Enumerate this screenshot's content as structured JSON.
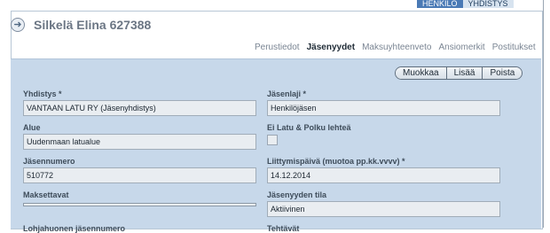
{
  "top_tabs": [
    {
      "label": "HENKILÖ",
      "active": true
    },
    {
      "label": "YHDISTYS",
      "active": false
    }
  ],
  "header": {
    "title": "Silkelä Elina 627388"
  },
  "subnav": [
    {
      "label": "Perustiedot",
      "active": false
    },
    {
      "label": "Jäsenyydet",
      "active": true
    },
    {
      "label": "Maksuyhteenveto",
      "active": false
    },
    {
      "label": "Ansiomerkit",
      "active": false
    },
    {
      "label": "Postitukset",
      "active": false
    }
  ],
  "actions": {
    "edit": "Muokkaa",
    "add": "Lisää",
    "delete": "Poista"
  },
  "fields": {
    "yhdistys": {
      "label": "Yhdistys *",
      "value": "VANTAAN LATU RY (Jäsenyhdistys)"
    },
    "jasenlaji": {
      "label": "Jäsenlaji *",
      "value": "Henkilöjäsen"
    },
    "alue": {
      "label": "Alue",
      "value": "Uudenmaan latualue"
    },
    "ei_latu_polku": {
      "label": "Ei Latu & Polku lehteä"
    },
    "jasennumero": {
      "label": "Jäsennumero",
      "value": "510772"
    },
    "liittymispaiva": {
      "label": "Liittymispäivä (muotoa pp.kk.vvvv) *",
      "value": "14.12.2014"
    },
    "maksettavat": {
      "label": "Maksettavat",
      "value": ""
    },
    "jasenyyden_tila": {
      "label": "Jäsenyyden tila",
      "value": "Aktiivinen"
    },
    "lahiohjaaja": {
      "label": "Lohjahuonen jäsennumero"
    },
    "tehtavat": {
      "label": "Tehtävät"
    }
  },
  "colors": {
    "content_background": "#c7d8ea",
    "active_tab": "#4a7ab5"
  }
}
